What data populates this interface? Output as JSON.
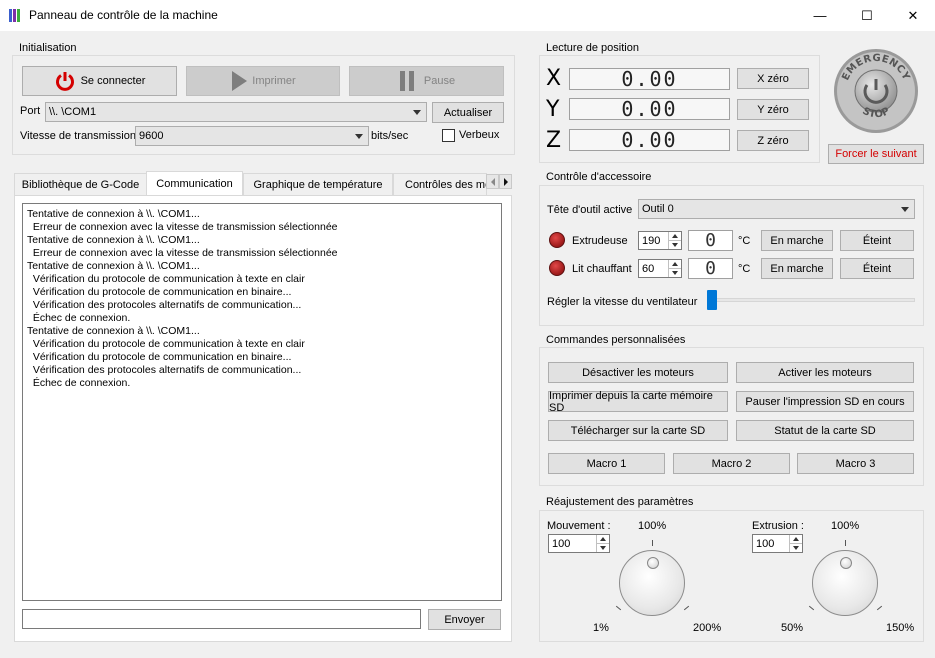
{
  "window": {
    "title": "Panneau de contrôle de la machine",
    "minimize": "—",
    "maximize": "☐",
    "close": "✕"
  },
  "colors": {
    "accent": "#0078d7",
    "danger_text": "#d40000",
    "led_red": "#b52020"
  },
  "initialisation": {
    "title": "Initialisation",
    "connect_label": "Se connecter",
    "print_label": "Imprimer",
    "pause_label": "Pause",
    "port_label": "Port",
    "port_value": "\\\\. \\COM1",
    "refresh_label": "Actualiser",
    "baud_label": "Vitesse de transmission",
    "baud_value": "9600",
    "baud_unit": "bits/sec",
    "verbose_label": "Verbeux"
  },
  "tabs": [
    {
      "label": "Bibliothèque de G-Code"
    },
    {
      "label": "Communication"
    },
    {
      "label": "Graphique de température"
    },
    {
      "label": "Contrôles des moteurs"
    }
  ],
  "console_lines": [
    "Tentative de connexion à \\\\. \\COM1...",
    "  Erreur de connexion avec la vitesse de transmission sélectionnée",
    "Tentative de connexion à \\\\. \\COM1...",
    "  Erreur de connexion avec la vitesse de transmission sélectionnée",
    "Tentative de connexion à \\\\. \\COM1...",
    "  Vérification du protocole de communication à texte en clair",
    "  Vérification du protocole de communication en binaire...",
    "  Vérification des protocoles alternatifs de communication...",
    "  Échec de connexion.",
    "Tentative de connexion à \\\\. \\COM1...",
    "  Vérification du protocole de communication à texte en clair",
    "  Vérification du protocole de communication en binaire...",
    "  Vérification des protocoles alternatifs de communication...",
    "  Échec de connexion."
  ],
  "send": {
    "input_value": "",
    "button_label": "Envoyer"
  },
  "position": {
    "title": "Lecture de position",
    "x_label": "X",
    "x_value": "0.00",
    "x_zero": "X zéro",
    "y_label": "Y",
    "y_value": "0.00",
    "y_zero": "Y zéro",
    "z_label": "Z",
    "z_value": "0.00",
    "z_zero": "Z zéro"
  },
  "emergency": {
    "top_text": "EMERGENCY",
    "bottom_text": "STOP",
    "force_label": "Forcer le suivant"
  },
  "accessory": {
    "title": "Contrôle d'accessoire",
    "tool_label": "Tête d'outil active",
    "tool_value": "Outil 0",
    "extruder_label": "Extrudeuse",
    "extruder_target": "190",
    "extruder_current": "0",
    "bed_label": "Lit chauffant",
    "bed_target": "60",
    "bed_current": "0",
    "unit": "°C",
    "on_label": "En marche",
    "off_label": "Éteint",
    "fan_label": "Régler la vitesse du ventilateur",
    "fan_speed_fraction": 0.0
  },
  "custom": {
    "title": "Commandes personnalisées",
    "disable_motors": "Désactiver les moteurs",
    "enable_motors": "Activer les moteurs",
    "print_sd": "Imprimer depuis la carte mémoire SD",
    "pause_sd": "Pauser l'impression SD en cours",
    "upload_sd": "Télécharger sur la carte SD",
    "sd_status": "Statut de la carte SD",
    "macro1": "Macro 1",
    "macro2": "Macro 2",
    "macro3": "Macro 3"
  },
  "params": {
    "title": "Réajustement des paramètres",
    "movement_label": "Mouvement :",
    "movement_value": "100",
    "movement_center": "100%",
    "movement_min": "1%",
    "movement_max": "200%",
    "extrusion_label": "Extrusion :",
    "extrusion_value": "100",
    "extrusion_center": "100%",
    "extrusion_min": "50%",
    "extrusion_max": "150%"
  }
}
